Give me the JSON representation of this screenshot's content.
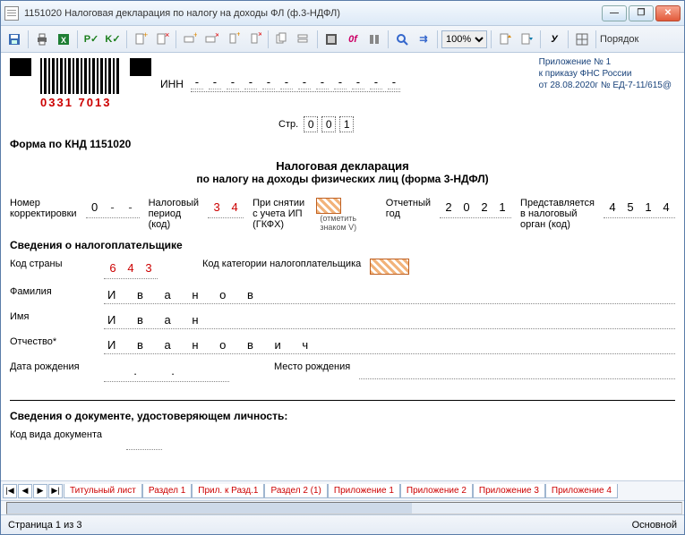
{
  "window": {
    "title": "1151020  Налоговая декларация по налогу на доходы ФЛ (ф.3-НДФЛ)"
  },
  "toolbar": {
    "zoom": "100%",
    "porjadok": "Порядок"
  },
  "attach": {
    "l1": "Приложение № 1",
    "l2": "к приказу ФНС России",
    "l3": "от 28.08.2020г № ЕД-7-11/615@"
  },
  "barcode_num": "0331 7013",
  "inn_label": "ИНН",
  "str_label": "Стр.",
  "str_cells": [
    "0",
    "0",
    "1"
  ],
  "knd": "Форма по КНД 1151020",
  "title1": "Налоговая декларация",
  "title2": "по налогу на доходы физических лиц (форма 3-НДФЛ)",
  "r1": {
    "corr_lbl": "Номер корректировки",
    "corr": [
      "0",
      "-",
      "-"
    ],
    "period_lbl": "Налоговый период (код)",
    "period": [
      "3",
      "4"
    ],
    "snip_lbl": "При снятии с учета ИП (ГКФХ)",
    "note": "(отметить знаком V)",
    "year_lbl": "Отчетный год",
    "year": [
      "2",
      "0",
      "2",
      "1"
    ],
    "organ_lbl": "Представляется в налоговый орган (код)",
    "organ": [
      "4",
      "5",
      "1",
      "4"
    ]
  },
  "sved_h": "Сведения о налогоплательщике",
  "r2": {
    "country_lbl": "Код страны",
    "country": [
      "6",
      "4",
      "3"
    ],
    "cat_lbl": "Код категории налогоплательщика"
  },
  "names": {
    "fam_lbl": "Фамилия",
    "fam": "И в а н о в",
    "name_lbl": "Имя",
    "name": "И в а н",
    "otch_lbl": "Отчество*",
    "otch": "И в а н о в и ч"
  },
  "dob_lbl": "Дата рождения",
  "pob_lbl": "Место рождения",
  "doc_h": "Сведения о документе, удостоверяющем личность:",
  "docvid_lbl": "Код вида документа",
  "tabs": [
    "Титульный лист",
    "Раздел 1",
    "Прил. к Разд.1",
    "Раздел 2 (1)",
    "Приложение 1",
    "Приложение 2",
    "Приложение 3",
    "Приложение 4"
  ],
  "status": {
    "pages": "Страница 1 из 3",
    "mode": "Основной"
  }
}
